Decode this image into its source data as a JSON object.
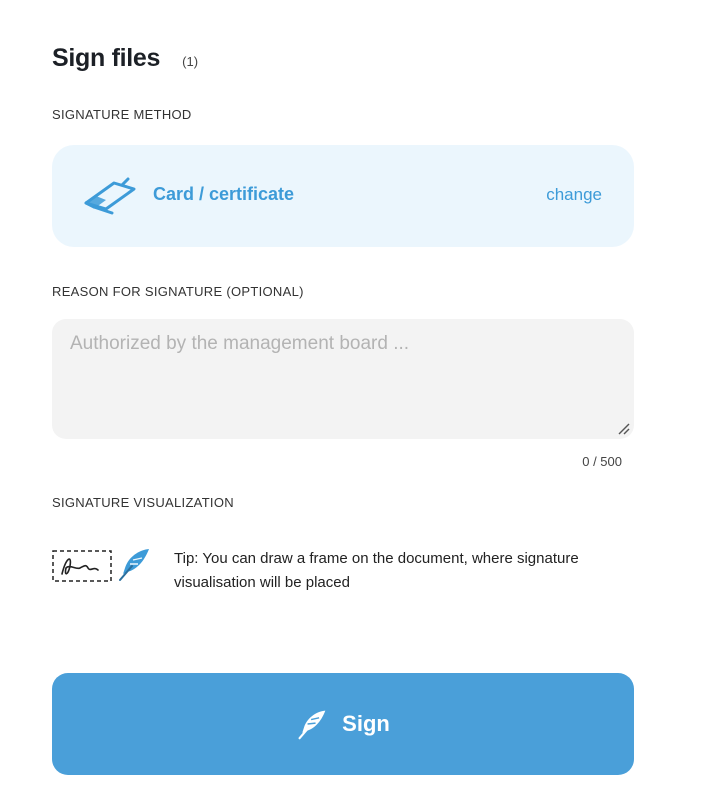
{
  "header": {
    "title": "Sign files",
    "file_count": "(1)"
  },
  "signature_method": {
    "section_label": "SIGNATURE METHOD",
    "method_name": "Card / certificate",
    "change_label": "change",
    "icon": "card-reader-icon"
  },
  "reason": {
    "section_label": "REASON FOR SIGNATURE (OPTIONAL)",
    "placeholder": "Authorized by the management board ...",
    "value": "",
    "counter": "0 / 500"
  },
  "visualization": {
    "section_label": "SIGNATURE VISUALIZATION",
    "tip": "Tip: You can draw a frame on the document, where signature visualisation will be placed",
    "icons": [
      "signature-frame-icon",
      "feather-pen-icon"
    ]
  },
  "actions": {
    "sign_label": "Sign",
    "sign_icon": "feather-pen-icon"
  },
  "colors": {
    "accent": "#4a9fd9",
    "card_background": "#ebf6fd",
    "input_background": "#f3f3f3"
  }
}
